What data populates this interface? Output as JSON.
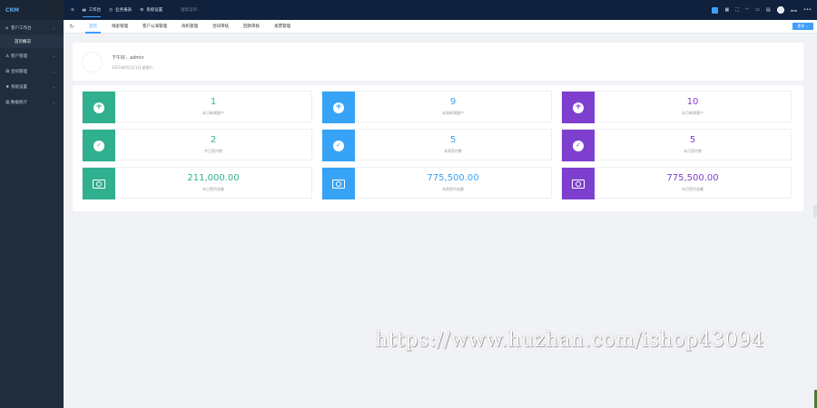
{
  "app": {
    "logo": "CRM"
  },
  "sidebar": {
    "items": [
      {
        "icon": "home-icon",
        "label": "客户工作台",
        "caret": "⌄",
        "children": [
          {
            "label": "首页概况"
          }
        ]
      },
      {
        "icon": "user-icon",
        "label": "客户管理",
        "caret": "⌄"
      },
      {
        "icon": "contract-icon",
        "label": "合同管理",
        "caret": "⌄"
      },
      {
        "icon": "star-icon",
        "label": "系统设置",
        "caret": "⌄"
      },
      {
        "icon": "list-icon",
        "label": "数据统计",
        "caret": "⌄"
      }
    ]
  },
  "topbar": {
    "menu_icon": "≡",
    "nav": [
      {
        "icon": "dashboard-icon",
        "glyph": "▮▮",
        "label": "工作台",
        "active": true
      },
      {
        "icon": "clock-icon",
        "glyph": "◷",
        "label": "业务报表",
        "active": false
      },
      {
        "icon": "gear-icon",
        "glyph": "⚙",
        "label": "系统设置",
        "active": false
      }
    ],
    "search_placeholder": "搜索菜单...",
    "more": "•••"
  },
  "tabs": {
    "refresh_icon": "↻",
    "items": [
      {
        "label": "首页",
        "active": true
      },
      {
        "label": "线索管理"
      },
      {
        "label": "客户公海管理"
      },
      {
        "label": "商机管理"
      },
      {
        "label": "合同审核"
      },
      {
        "label": "回款审核"
      },
      {
        "label": "发票管理"
      }
    ],
    "more_label": "更多 ⌄"
  },
  "welcome": {
    "greeting": "下午好，admin",
    "date": "2021年05月11日 星期二"
  },
  "stats": [
    {
      "value": "1",
      "label": "本日新增客户",
      "color": "green",
      "icon": "plus"
    },
    {
      "value": "9",
      "label": "本周新增客户",
      "color": "blue",
      "icon": "plus"
    },
    {
      "value": "10",
      "label": "本月新增客户",
      "color": "purple",
      "icon": "plus"
    },
    {
      "value": "2",
      "label": "今日签约数",
      "color": "green",
      "icon": "check"
    },
    {
      "value": "5",
      "label": "本周签约数",
      "color": "blue",
      "icon": "check"
    },
    {
      "value": "5",
      "label": "本月签约数",
      "color": "purple",
      "icon": "check"
    },
    {
      "value": "211,000.00",
      "label": "本日签约金额",
      "color": "green",
      "icon": "money"
    },
    {
      "value": "775,500.00",
      "label": "本周签约金额",
      "color": "blue",
      "icon": "money"
    },
    {
      "value": "775,500.00",
      "label": "本月签约金额",
      "color": "purple",
      "icon": "money"
    }
  ],
  "colors": {
    "green": "#30b08f",
    "blue": "#36a3f7",
    "purple": "#7e3fcf",
    "sidebar": "#1f2d3d",
    "topbar": "#10213d",
    "accent": "#409eff"
  },
  "watermark": "https://www.huzhan.com/ishop43094"
}
